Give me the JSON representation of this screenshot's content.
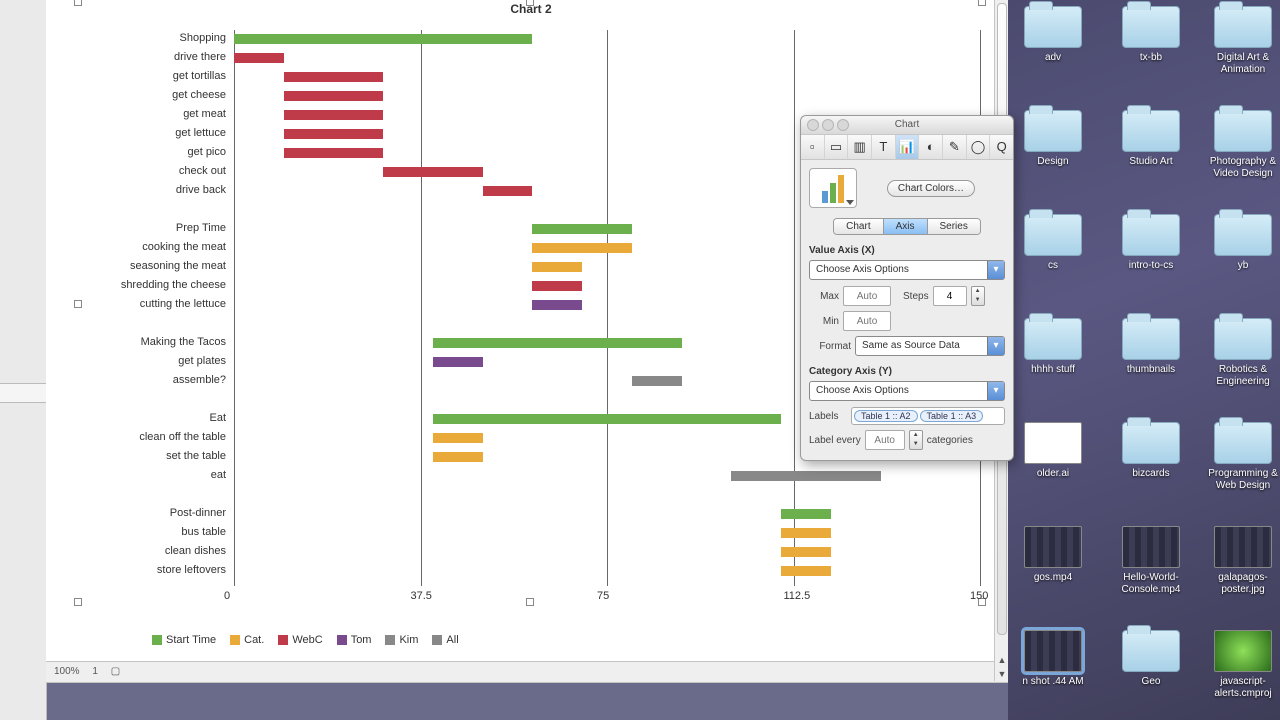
{
  "statusbar": {
    "zoom": "100%",
    "page": "1"
  },
  "chart": {
    "title": "Chart 2",
    "x_ticks": [
      0,
      37.5,
      75,
      112.5,
      150
    ],
    "legend": [
      {
        "label": "Start Time",
        "class": "c-start"
      },
      {
        "label": "Cat.",
        "class": "c-cat"
      },
      {
        "label": "WebC",
        "class": "c-webc"
      },
      {
        "label": "Tom",
        "class": "c-tom"
      },
      {
        "label": "Kim",
        "class": "c-kim"
      },
      {
        "label": "All",
        "class": "c-all"
      }
    ]
  },
  "chart_data": {
    "type": "bar",
    "orientation": "horizontal-stacked",
    "xlabel": "",
    "ylabel": "",
    "xlim": [
      0,
      150
    ],
    "series_names": [
      "Start Time",
      "Cat.",
      "WebC",
      "Tom",
      "Kim",
      "All"
    ],
    "series_colors": {
      "Start Time": "#6cb04e",
      "Cat.": "#eaaa3a",
      "WebC": "#bf3b4a",
      "Tom": "#7a4a8e",
      "Kim": "#888888",
      "All": "#888888"
    },
    "note": "Start Time is an invisible offset segment used to build a Gantt chart; its value is the bar's left edge.",
    "tasks": [
      {
        "label": "Shopping",
        "segments": [
          {
            "series": "Start Time",
            "start": 0,
            "length": 60,
            "visible": true
          }
        ]
      },
      {
        "label": "drive there",
        "segments": [
          {
            "series": "Start Time",
            "start": 0,
            "length": 0
          },
          {
            "series": "WebC",
            "start": 0,
            "length": 10
          }
        ]
      },
      {
        "label": "get tortillas",
        "segments": [
          {
            "series": "Start Time",
            "start": 0,
            "length": 10
          },
          {
            "series": "WebC",
            "start": 10,
            "length": 20
          }
        ]
      },
      {
        "label": "get cheese",
        "segments": [
          {
            "series": "Start Time",
            "start": 0,
            "length": 10
          },
          {
            "series": "WebC",
            "start": 10,
            "length": 20
          }
        ]
      },
      {
        "label": "get meat",
        "segments": [
          {
            "series": "Start Time",
            "start": 0,
            "length": 10
          },
          {
            "series": "WebC",
            "start": 10,
            "length": 20
          }
        ]
      },
      {
        "label": "get lettuce",
        "segments": [
          {
            "series": "Start Time",
            "start": 0,
            "length": 10
          },
          {
            "series": "WebC",
            "start": 10,
            "length": 20
          }
        ]
      },
      {
        "label": "get pico",
        "segments": [
          {
            "series": "Start Time",
            "start": 0,
            "length": 10
          },
          {
            "series": "WebC",
            "start": 10,
            "length": 20
          }
        ]
      },
      {
        "label": "check out",
        "segments": [
          {
            "series": "Start Time",
            "start": 0,
            "length": 30
          },
          {
            "series": "WebC",
            "start": 30,
            "length": 20
          }
        ]
      },
      {
        "label": "drive back",
        "segments": [
          {
            "series": "Start Time",
            "start": 0,
            "length": 50
          },
          {
            "series": "WebC",
            "start": 50,
            "length": 10
          }
        ]
      },
      {
        "label": "",
        "blank": true
      },
      {
        "label": "Prep Time",
        "segments": [
          {
            "series": "Start Time",
            "start": 60,
            "length": 20,
            "visible": true
          }
        ]
      },
      {
        "label": "cooking the meat",
        "segments": [
          {
            "series": "Start Time",
            "start": 0,
            "length": 60
          },
          {
            "series": "Cat.",
            "start": 60,
            "length": 20
          }
        ]
      },
      {
        "label": "seasoning the meat",
        "segments": [
          {
            "series": "Start Time",
            "start": 0,
            "length": 60
          },
          {
            "series": "Cat.",
            "start": 60,
            "length": 10
          }
        ]
      },
      {
        "label": "shredding the cheese",
        "segments": [
          {
            "series": "Start Time",
            "start": 0,
            "length": 60
          },
          {
            "series": "WebC",
            "start": 60,
            "length": 10
          }
        ]
      },
      {
        "label": "cutting the lettuce",
        "segments": [
          {
            "series": "Start Time",
            "start": 0,
            "length": 60
          },
          {
            "series": "Tom",
            "start": 60,
            "length": 10
          }
        ]
      },
      {
        "label": "",
        "blank": true
      },
      {
        "label": "Making the Tacos",
        "segments": [
          {
            "series": "Start Time",
            "start": 40,
            "length": 50,
            "visible": true
          }
        ]
      },
      {
        "label": "get plates",
        "segments": [
          {
            "series": "Start Time",
            "start": 0,
            "length": 40
          },
          {
            "series": "Tom",
            "start": 40,
            "length": 10
          }
        ]
      },
      {
        "label": "assemble?",
        "segments": [
          {
            "series": "Start Time",
            "start": 0,
            "length": 80
          },
          {
            "series": "Kim",
            "start": 80,
            "length": 10
          }
        ]
      },
      {
        "label": "",
        "blank": true
      },
      {
        "label": "Eat",
        "segments": [
          {
            "series": "Start Time",
            "start": 40,
            "length": 70,
            "visible": true
          }
        ]
      },
      {
        "label": "clean off the table",
        "segments": [
          {
            "series": "Start Time",
            "start": 0,
            "length": 40
          },
          {
            "series": "Cat.",
            "start": 40,
            "length": 10
          }
        ]
      },
      {
        "label": "set the table",
        "segments": [
          {
            "series": "Start Time",
            "start": 0,
            "length": 40
          },
          {
            "series": "Cat.",
            "start": 40,
            "length": 10
          }
        ]
      },
      {
        "label": "eat",
        "segments": [
          {
            "series": "Start Time",
            "start": 0,
            "length": 100
          },
          {
            "series": "All",
            "start": 100,
            "length": 30
          }
        ]
      },
      {
        "label": "",
        "blank": true
      },
      {
        "label": "Post-dinner",
        "segments": [
          {
            "series": "Start Time",
            "start": 110,
            "length": 10,
            "visible": true
          }
        ]
      },
      {
        "label": "bus table",
        "segments": [
          {
            "series": "Start Time",
            "start": 0,
            "length": 110
          },
          {
            "series": "Cat.",
            "start": 110,
            "length": 10
          }
        ]
      },
      {
        "label": "clean dishes",
        "segments": [
          {
            "series": "Start Time",
            "start": 0,
            "length": 110
          },
          {
            "series": "Cat.",
            "start": 110,
            "length": 10
          }
        ]
      },
      {
        "label": "store leftovers",
        "segments": [
          {
            "series": "Start Time",
            "start": 0,
            "length": 110
          },
          {
            "series": "Cat.",
            "start": 110,
            "length": 10
          }
        ]
      }
    ]
  },
  "inspector": {
    "title": "Chart",
    "chart_colors_btn": "Chart Colors…",
    "subtabs": [
      "Chart",
      "Axis",
      "Series"
    ],
    "value_axis": {
      "heading": "Value Axis (X)",
      "options_label": "Choose Axis Options",
      "max_label": "Max",
      "max_value": "Auto",
      "min_label": "Min",
      "min_value": "Auto",
      "steps_label": "Steps",
      "steps_value": "4",
      "format_label": "Format",
      "format_value": "Same as Source Data"
    },
    "category_axis": {
      "heading": "Category Axis (Y)",
      "options_label": "Choose Axis Options",
      "labels_label": "Labels",
      "tokens": [
        "Table 1 :: A2",
        "Table 1 :: A3"
      ],
      "label_every_label": "Label every",
      "label_every_value": "Auto",
      "categories_suffix": "categories"
    }
  },
  "desktop": {
    "cols_x": [
      0,
      98,
      190
    ],
    "rows": [
      [
        {
          "t": "folder",
          "l": "adv"
        },
        {
          "t": "folder",
          "l": "tx-bb"
        },
        {
          "t": "folder",
          "l": "Digital Art & Animation"
        }
      ],
      [
        {
          "t": "folder",
          "l": "Design"
        },
        {
          "t": "folder",
          "l": "Studio Art"
        },
        {
          "t": "folder",
          "l": "Photography & Video Design"
        }
      ],
      [
        {
          "t": "folder",
          "l": "cs"
        },
        {
          "t": "folder",
          "l": "intro-to-cs"
        },
        {
          "t": "folder",
          "l": "yb"
        }
      ],
      [
        {
          "t": "folder",
          "l": "hhhh stuff"
        },
        {
          "t": "folder",
          "l": "thumbnails"
        },
        {
          "t": "folder",
          "l": "Robotics & Engineering"
        }
      ],
      [
        {
          "t": "file",
          "l": "older.ai"
        },
        {
          "t": "folder",
          "l": "bizcards"
        },
        {
          "t": "folder",
          "l": "Programming & Web Design"
        }
      ],
      [
        {
          "t": "img",
          "l": "gos.mp4"
        },
        {
          "t": "img",
          "l": "Hello-World-Console.mp4"
        },
        {
          "t": "img",
          "l": "galapagos-poster.jpg"
        }
      ],
      [
        {
          "t": "img",
          "l": "n shot .44 AM",
          "sel": true
        },
        {
          "t": "folder",
          "l": "Geo"
        },
        {
          "t": "img",
          "l": "javascript-alerts.cmproj",
          "green": true
        }
      ]
    ]
  }
}
